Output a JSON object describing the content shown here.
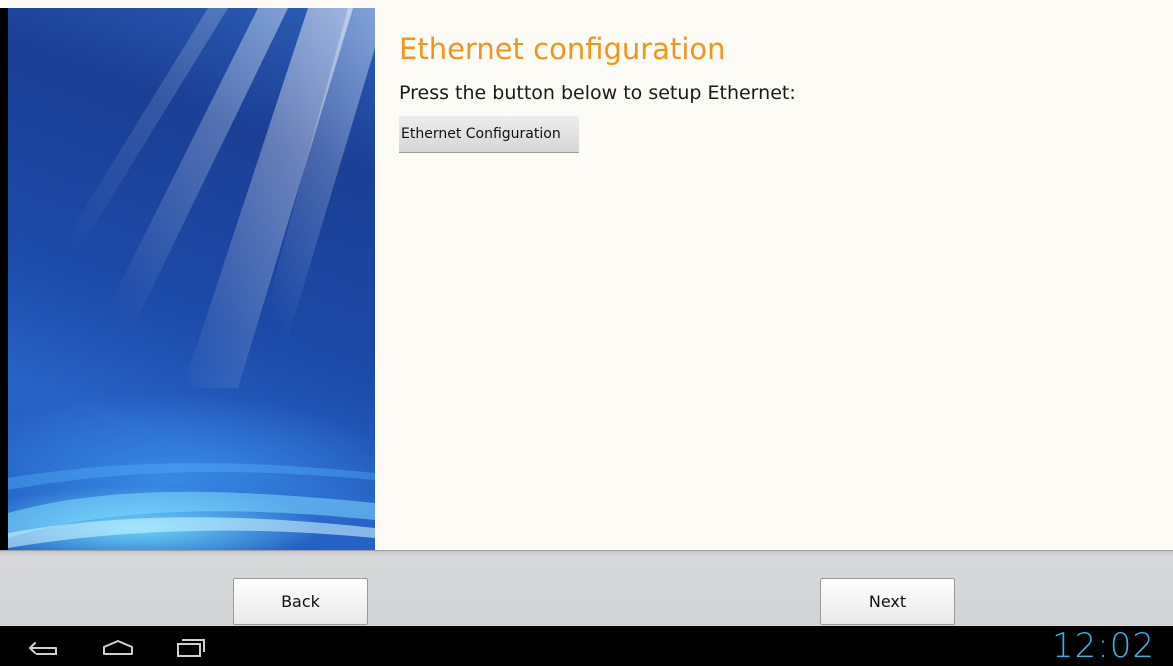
{
  "wizard": {
    "title": "Ethernet configuration",
    "instruction": "Press the button below to setup Ethernet:",
    "ethernet_button_label": "Ethernet Configuration"
  },
  "footer": {
    "back_label": "Back",
    "next_label": "Next"
  },
  "system_bar": {
    "icons": [
      "back-icon",
      "home-icon",
      "recent-apps-icon"
    ],
    "clock": "12:02"
  },
  "colors": {
    "title": "#f0961c",
    "clock": "#33b5e5"
  }
}
